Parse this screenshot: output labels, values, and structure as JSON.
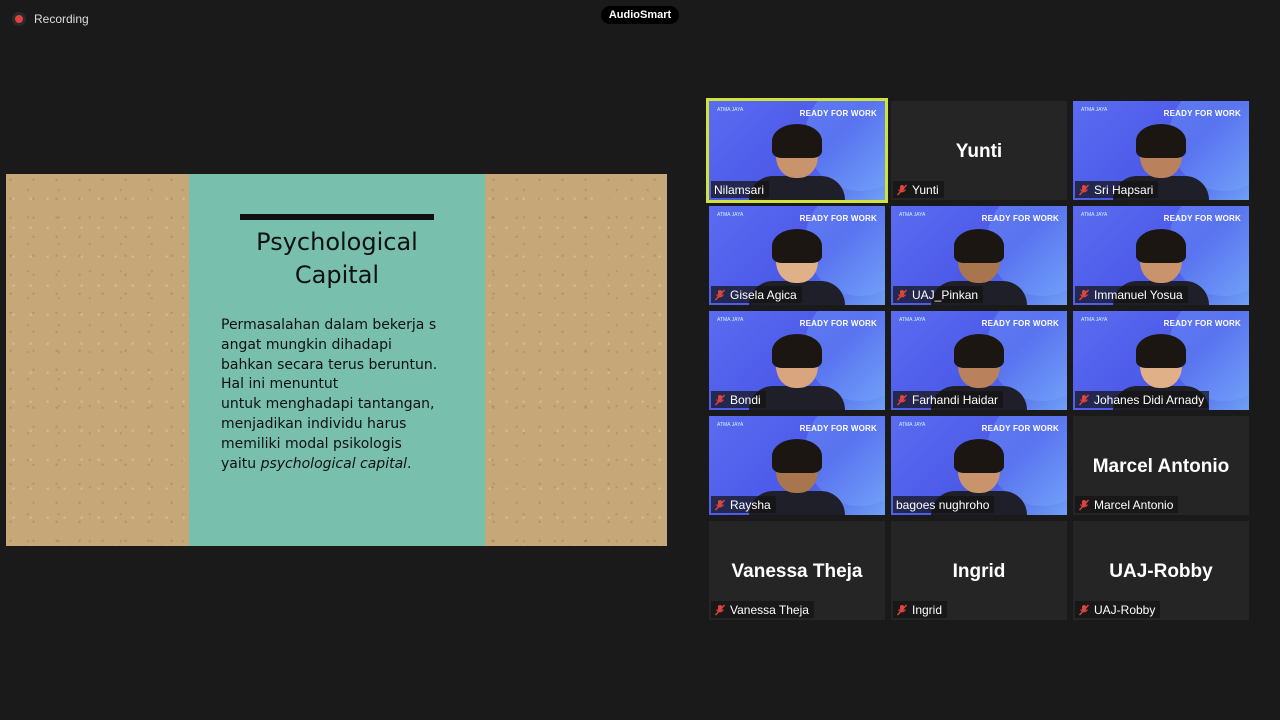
{
  "top": {
    "recording_label": "Recording",
    "brand_label": "AudioSmart"
  },
  "slide": {
    "title_line1": "Psychological",
    "title_line2": "Capital",
    "body_lines": [
      "Permasalahan dalam bekerja s",
      "angat mungkin dihadapi",
      "bahkan secara terus beruntun.",
      "Hal ini menuntut",
      "untuk menghadapi tantangan,",
      "menjadikan individu harus",
      "memiliki modal psikologis"
    ],
    "body_last_prefix": "yaitu ",
    "body_last_italic": "psychological capital",
    "body_last_suffix": "."
  },
  "tile_banner": {
    "ready": "READY FOR WORK",
    "logo": "ATMA JAYA"
  },
  "participants": [
    {
      "name": "Nilamsari",
      "video": true,
      "muted": false,
      "active": true
    },
    {
      "name": "Yunti",
      "video": false,
      "muted": true,
      "active": false
    },
    {
      "name": "Sri Hapsari",
      "video": true,
      "muted": true,
      "active": false
    },
    {
      "name": "Gisela Agica",
      "video": true,
      "muted": true,
      "active": false
    },
    {
      "name": "UAJ_Pinkan",
      "video": true,
      "muted": true,
      "active": false
    },
    {
      "name": "Immanuel Yosua",
      "video": true,
      "muted": true,
      "active": false
    },
    {
      "name": "Bondi",
      "video": true,
      "muted": true,
      "active": false
    },
    {
      "name": "Farhandi Haidar",
      "video": true,
      "muted": true,
      "active": false
    },
    {
      "name": "Johanes Didi Arnady",
      "video": true,
      "muted": true,
      "active": false
    },
    {
      "name": "Raysha",
      "video": true,
      "muted": true,
      "active": false
    },
    {
      "name": "bagoes nughroho",
      "video": true,
      "muted": false,
      "active": false
    },
    {
      "name": "Marcel Antonio",
      "video": false,
      "muted": true,
      "active": false
    },
    {
      "name": "Vanessa Theja",
      "video": false,
      "muted": true,
      "active": false
    },
    {
      "name": "Ingrid",
      "video": false,
      "muted": true,
      "active": false
    },
    {
      "name": "UAJ-Robby",
      "video": false,
      "muted": true,
      "active": false
    }
  ],
  "colors": {
    "background": "#1a1a1a",
    "active_speaker_border": "#cfe33a",
    "mute_icon": "#e0443e",
    "slide_panel": "#79bfae",
    "cardboard": "#c6a878"
  }
}
